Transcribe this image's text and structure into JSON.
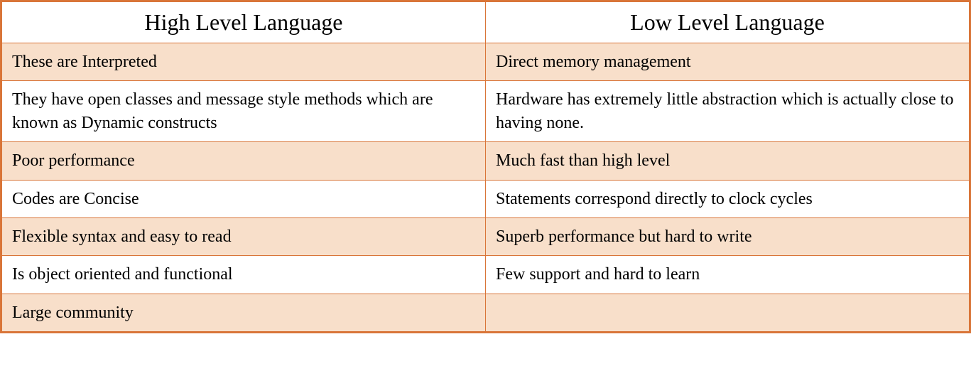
{
  "chart_data": {
    "type": "table",
    "headers": [
      "High Level Language",
      "Low Level Language"
    ],
    "rows": [
      [
        "These are Interpreted",
        "Direct memory management"
      ],
      [
        "They have open classes and message style methods which are known as Dynamic constructs",
        "Hardware has extremely little abstraction which is actually close to having none."
      ],
      [
        "Poor performance",
        "Much fast than high level"
      ],
      [
        "Codes are Concise",
        "Statements correspond directly to clock cycles"
      ],
      [
        "Flexible syntax and easy to read",
        "Superb performance but hard to write"
      ],
      [
        "Is object oriented and functional",
        "Few support and hard to learn"
      ],
      [
        "Large community",
        ""
      ]
    ]
  },
  "table": {
    "header": {
      "col1": "High Level Language",
      "col2": "Low Level Language"
    },
    "rows": [
      {
        "col1": "These are Interpreted",
        "col2": "Direct memory management"
      },
      {
        "col1": "They have open classes and message style methods which are known as Dynamic constructs",
        "col2": "Hardware has extremely little abstraction which is actually close to having none."
      },
      {
        "col1": "Poor performance",
        "col2": "Much fast than high level"
      },
      {
        "col1": "Codes are Concise",
        "col2": "Statements correspond directly to clock cycles"
      },
      {
        "col1": "Flexible syntax and easy to read",
        "col2": "Superb performance but hard to write"
      },
      {
        "col1": "Is object oriented and functional",
        "col2": "Few support and hard to learn"
      },
      {
        "col1": "Large community",
        "col2": ""
      }
    ]
  }
}
